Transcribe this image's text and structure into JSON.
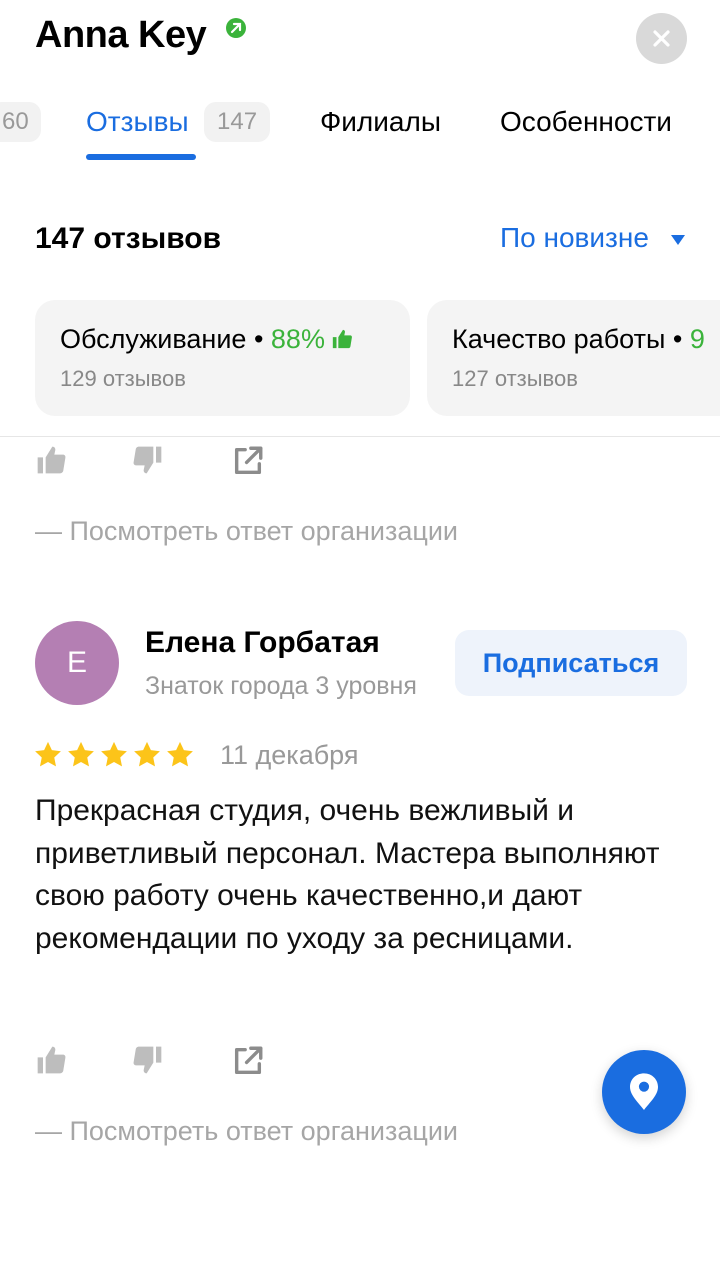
{
  "header": {
    "title": "Anna Key",
    "verified_icon": "verified-arrow-icon",
    "close_icon": "close-icon"
  },
  "tabs": {
    "prev_count": "60",
    "reviews_label": "Отзывы",
    "reviews_count": "147",
    "branches_label": "Филиалы",
    "features_label": "Особенности",
    "active_color": "#1a6de0"
  },
  "summary": {
    "count_label": "147 отзывов",
    "sort_label": "По новизне"
  },
  "aspects": [
    {
      "name": "Обслуживание",
      "percent": "88%",
      "reviews": "129 отзывов"
    },
    {
      "name": "Качество работы",
      "percent": "9",
      "reviews": "127 отзывов"
    }
  ],
  "previous_review": {
    "reply_link": "— Посмотреть ответ организации"
  },
  "review": {
    "avatar_letter": "Е",
    "author": "Елена Горбатая",
    "level": "Знаток города 3 уровня",
    "subscribe_label": "Подписаться",
    "rating": 5,
    "date": "11 декабря",
    "text": "Прекрасная студия, очень вежливый и приветливый персонал. Мастера выполняют свою работу очень качественно,и дают рекомендации по уходу за ресницами.",
    "reply_link": "— Посмотреть ответ организации"
  },
  "colors": {
    "accent": "#1a6de0",
    "positive": "#3bb33b",
    "star": "#fcc419",
    "avatar": "#b47fb3"
  },
  "fab": {
    "icon": "map-pin-icon"
  }
}
